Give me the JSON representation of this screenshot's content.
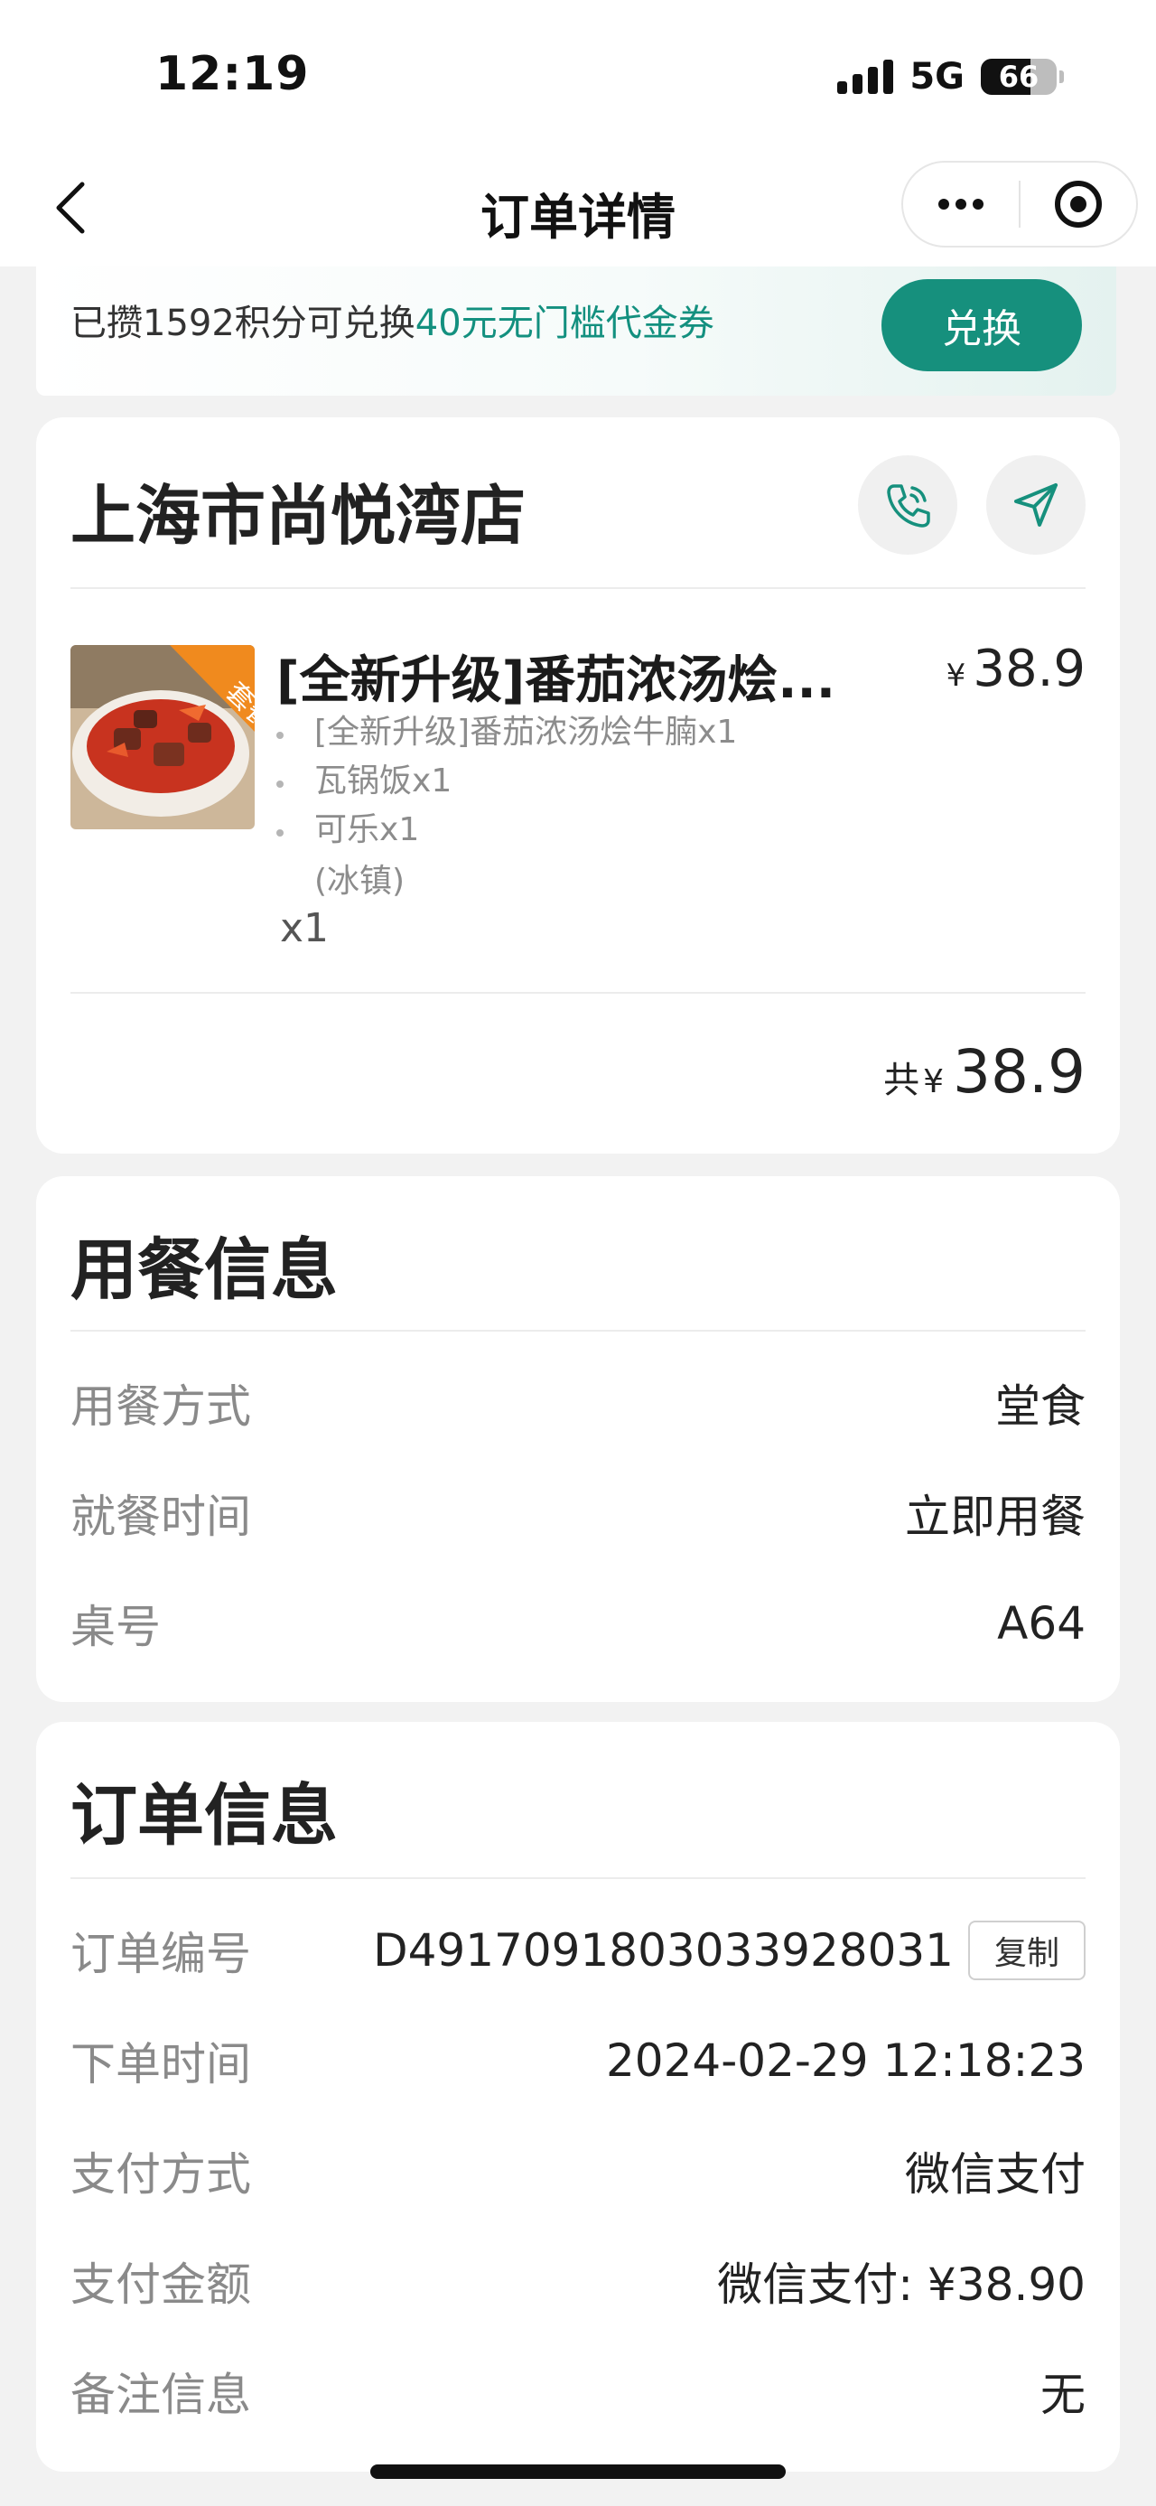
{
  "status_bar": {
    "time": "12:19",
    "network": "5G",
    "battery": "66",
    "battery_level": 0.66
  },
  "nav": {
    "title": "订单详情"
  },
  "points_banner": {
    "prefix": "已攒1592积分可兑换",
    "highlight": "40元无门槛代金券",
    "button": "兑换",
    "accent_color": "#13907f"
  },
  "store": {
    "name": "上海市尚悦湾店",
    "item": {
      "title": "[全新升级]番茄浓汤烩...",
      "badge": "套餐",
      "price_symbol": "¥",
      "price": "38.9",
      "components": [
        {
          "prefix": "[全新升级]番茄浓汤烩牛腩",
          "qty": "x1"
        },
        {
          "prefix": "瓦锅饭",
          "qty": "x1"
        },
        {
          "prefix": "可乐",
          "qty": "x1"
        }
      ],
      "component_note": "(冰镇)",
      "quantity": "x1"
    },
    "total": {
      "label": "共",
      "symbol": "¥",
      "amount": "38.9"
    }
  },
  "dining_info": {
    "title": "用餐信息",
    "rows": [
      {
        "key": "用餐方式",
        "value": "堂食"
      },
      {
        "key": "就餐时间",
        "value": "立即用餐"
      },
      {
        "key": "桌号",
        "value": "A64"
      }
    ]
  },
  "order_info": {
    "title": "订单信息",
    "rows": [
      {
        "key": "订单编号",
        "value": "D4917091803033928031"
      },
      {
        "key": "下单时间",
        "value": "2024-02-29 12:18:23"
      },
      {
        "key": "支付方式",
        "value": "微信支付"
      },
      {
        "key": "支付金额",
        "value": "微信支付: ¥38.90"
      },
      {
        "key": "备注信息",
        "value": "无"
      }
    ],
    "copy_button": "复制"
  }
}
